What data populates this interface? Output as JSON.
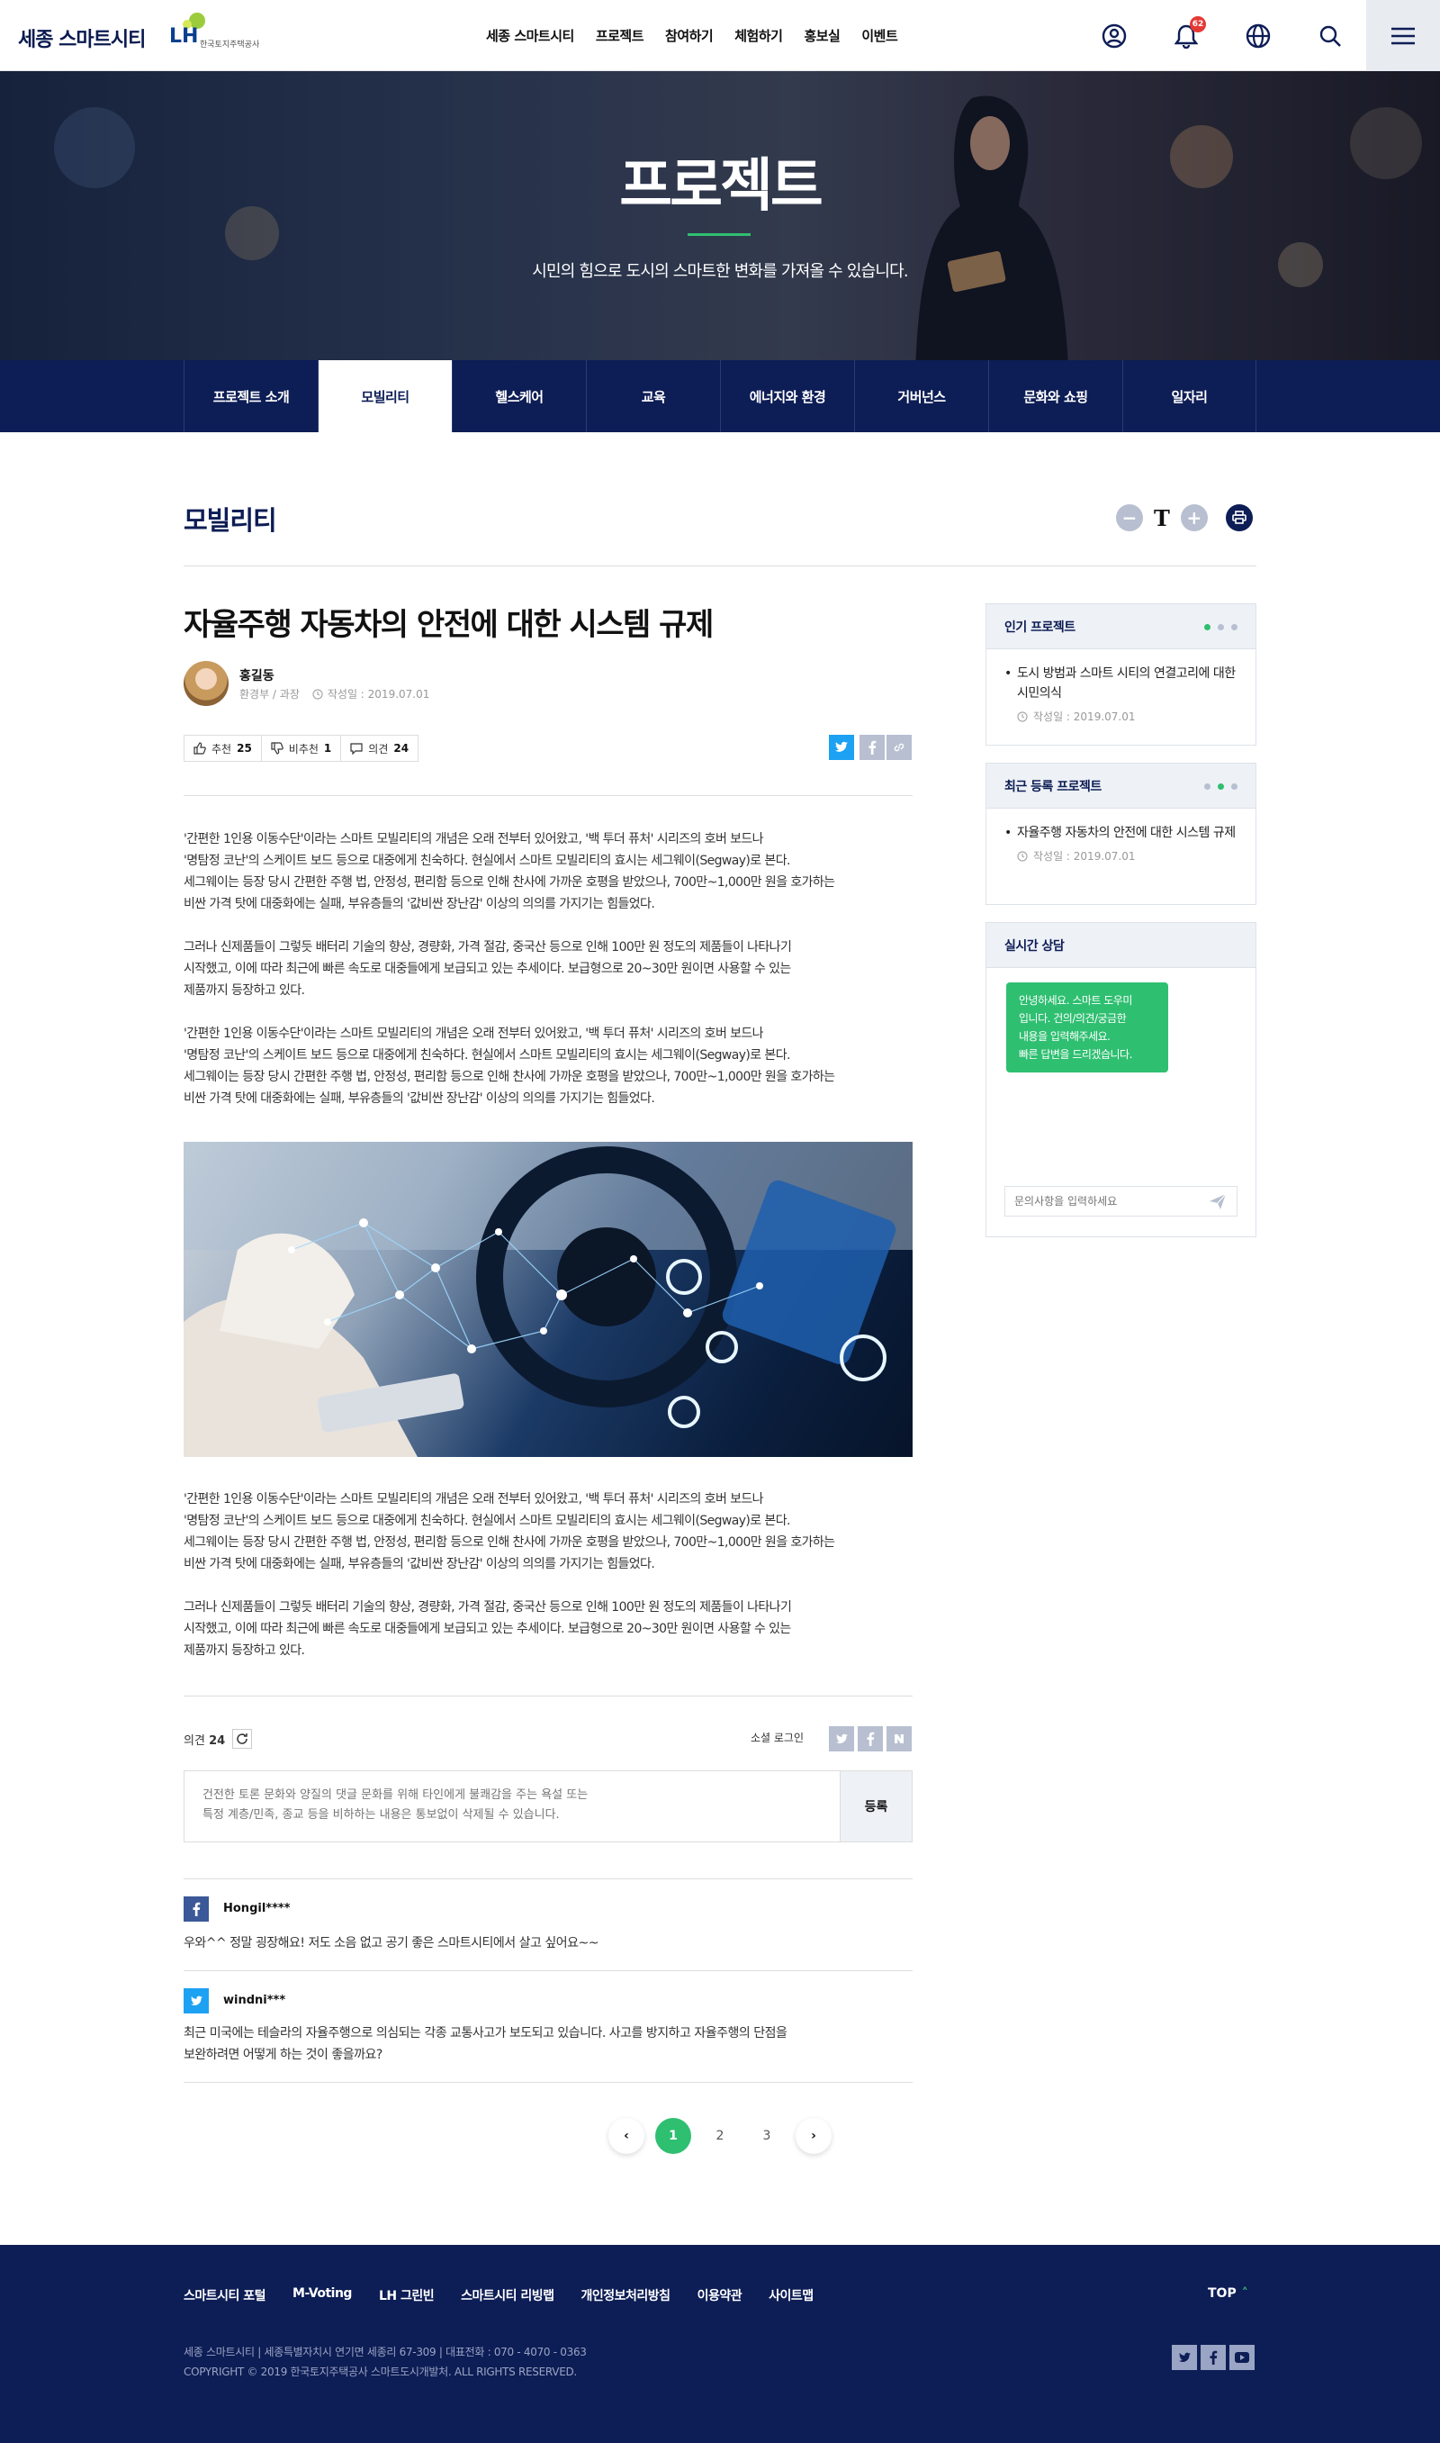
{
  "header": {
    "logo_text": "세종 스마트시티",
    "lh_mark": "LH",
    "lh_sub": "한국토지주택공사",
    "nav": [
      "세종 스마트시티",
      "프로젝트",
      "참여하기",
      "체험하기",
      "홍보실",
      "이벤트"
    ],
    "notification_count": "62",
    "icons": [
      "user-icon",
      "bell-icon",
      "globe-icon",
      "search-icon",
      "menu-icon"
    ]
  },
  "hero": {
    "title": "프로젝트",
    "subtitle": "시민의 힘으로 도시의 스마트한 변화를 가져올 수 있습니다."
  },
  "subnav": {
    "tabs": [
      "프로젝트 소개",
      "모빌리티",
      "헬스케어",
      "교육",
      "에너지와 환경",
      "거버넌스",
      "문화와 쇼핑",
      "일자리"
    ],
    "active_index": 1
  },
  "section": {
    "title": "모빌리티",
    "font_minus": "−",
    "font_t": "T",
    "font_plus": "+"
  },
  "article": {
    "title": "자율주행 자동차의 안전에 대한 시스템 규제",
    "author": {
      "name": "홍길동",
      "dept": "환경부 / 과장",
      "date": "작성일 : 2019.07.01"
    },
    "reactions": {
      "like_label": "추천",
      "like_count": "25",
      "dislike_label": "비추천",
      "dislike_count": "1",
      "comment_label": "의견",
      "comment_count": "24"
    },
    "paragraphs": [
      "'간편한 1인용 이동수단'이라는 스마트 모빌리티의 개념은 오래 전부터 있어왔고, '백 투더 퓨처' 시리즈의 호버 보드나\n'명탐정 코난'의 스케이트 보드 등으로 대중에게 친숙하다. 현실에서 스마트 모빌리티의 효시는 세그웨이(Segway)로 본다.\n세그웨이는 등장 당시 간편한 주행 법, 안정성, 편리함 등으로 인해 찬사에 가까운 호평을 받았으나, 700만~1,000만 원을 호가하는\n비싼 가격 탓에 대중화에는 실패, 부유층들의 '값비싼 장난감' 이상의 의의를 가지기는 힘들었다.",
      "그러나 신제품들이 그렇듯 배터리 기술의 향상, 경량화, 가격 절감, 중국산 등으로 인해 100만 원 정도의 제품들이 나타나기\n시작했고, 이에 따라 최근에 빠른 속도로 대중들에게 보급되고 있는 추세이다. 보급형으로 20~30만 원이면 사용할 수 있는\n제품까지 등장하고 있다.",
      "'간편한 1인용 이동수단'이라는 스마트 모빌리티의 개념은 오래 전부터 있어왔고, '백 투더 퓨처' 시리즈의 호버 보드나\n'명탐정 코난'의 스케이트 보드 등으로 대중에게 친숙하다. 현실에서 스마트 모빌리티의 효시는 세그웨이(Segway)로 본다.\n세그웨이는 등장 당시 간편한 주행 법, 안정성, 편리함 등으로 인해 찬사에 가까운 호평을 받았으나, 700만~1,000만 원을 호가하는\n비싼 가격 탓에 대중화에는 실패, 부유층들의 '값비싼 장난감' 이상의 의의를 가지기는 힘들었다.",
      "'간편한 1인용 이동수단'이라는 스마트 모빌리티의 개념은 오래 전부터 있어왔고, '백 투더 퓨처' 시리즈의 호버 보드나\n'명탐정 코난'의 스케이트 보드 등으로 대중에게 친숙하다. 현실에서 스마트 모빌리티의 효시는 세그웨이(Segway)로 본다.\n세그웨이는 등장 당시 간편한 주행 법, 안정성, 편리함 등으로 인해 찬사에 가까운 호평을 받았으나, 700만~1,000만 원을 호가하는\n비싼 가격 탓에 대중화에는 실패, 부유층들의 '값비싼 장난감' 이상의 의의를 가지기는 힘들었다.",
      "그러나 신제품들이 그렇듯 배터리 기술의 향상, 경량화, 가격 절감, 중국산 등으로 인해 100만 원 정도의 제품들이 나타나기\n시작했고, 이에 따라 최근에 빠른 속도로 대중들에게 보급되고 있는 추세이다. 보급형으로 20~30만 원이면 사용할 수 있는\n제품까지 등장하고 있다."
    ]
  },
  "comments": {
    "count_label": "의견",
    "count": "24",
    "social_login_label": "소셜 로그인",
    "input_placeholder": "건전한 토론 문화와 양질의 댓글 문화를 위해 타인에게 불쾌감을 주는 욕설 또는\n특정 계층/민족, 종교 등을 비하하는 내용은 통보없이 삭제될 수 있습니다.",
    "submit_label": "등록",
    "items": [
      {
        "provider": "f",
        "user": "Hongil****",
        "text": "우와^^ 정말 굉장해요! 저도 소음 없고 공기 좋은 스마트시티에서 살고 싶어요~~"
      },
      {
        "provider": "t",
        "user": "windni***",
        "text": "최근 미국에는 테슬라의 자율주행으로 의심되는 각종 교통사고가 보도되고 있습니다. 사고를 방지하고 자율주행의 단점을\n보완하려면 어떻게 하는 것이 좋을까요?"
      }
    ]
  },
  "pagination": {
    "prev": "‹",
    "pages": [
      "1",
      "2",
      "3"
    ],
    "current": "1",
    "next": "›"
  },
  "sidebar": {
    "popular": {
      "title": "인기 프로젝트",
      "item": "도시 방범과 스마트 시티의 연결고리에 대한 시민의식",
      "date": "작성일 : 2019.07.01"
    },
    "recent": {
      "title": "최근 등록 프로젝트",
      "item": "자율주행 자동차의 안전에 대한 시스템 규제",
      "date": "작성일 : 2019.07.01"
    },
    "chat": {
      "title": "실시간 상담",
      "bubble": "안녕하세요. 스마트 도우미\n입니다. 건의/의견/궁금한\n내용을 입력해주세요.\n빠른 답변을 드리겠습니다.",
      "input_placeholder": "문의사항을 입력하세요"
    }
  },
  "footer": {
    "links": [
      "스마트시티 포털",
      "M-Voting",
      "LH 그린빈",
      "스마트시티 리빙랩",
      "개인정보처리방침",
      "이용약관",
      "사이트맵"
    ],
    "top_label": "TOP",
    "address": "세종 스마트시티 | 세종특별자치시 연기면 세종리 67-309  | 대표전화 : 070 - 4070 - 0363",
    "copyright": "COPYRIGHT © 2019 한국토지주택공사 스마트도시개발처. ALL RIGHTS RESERVED."
  },
  "colors": {
    "navy": "#0d1d55",
    "green": "#2fbf71",
    "twitter": "#1da1f2",
    "facebook": "#3b5998"
  }
}
